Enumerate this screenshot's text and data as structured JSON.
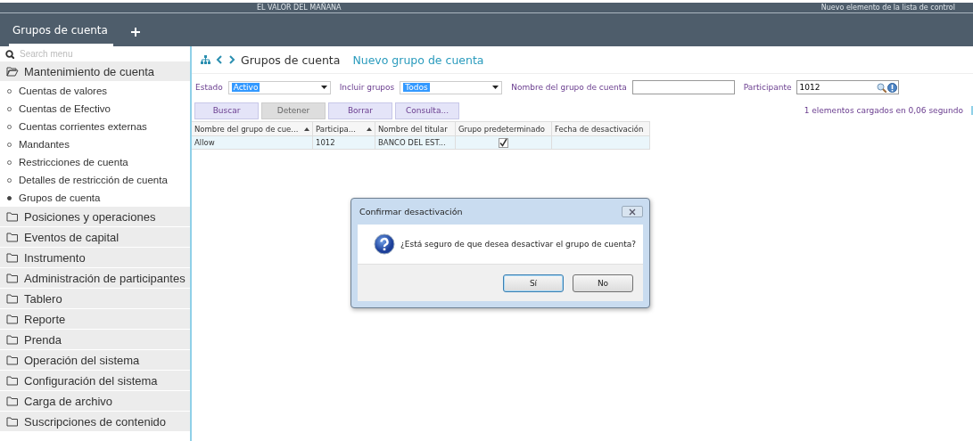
{
  "header": {
    "tagline": "EL VALOR DEL MAÑANA",
    "notice": "Nuevo elemento de la lista de control"
  },
  "tabs": [
    {
      "label": "Grupos de cuenta",
      "selected": true
    }
  ],
  "sidebar": {
    "search": {
      "placeholder": "Search menu"
    },
    "items": [
      {
        "label": "Mantenimiento de cuenta",
        "expanded": true,
        "children": [
          {
            "label": "Cuentas de valores",
            "selected": false
          },
          {
            "label": "Cuentas de Efectivo",
            "selected": false
          },
          {
            "label": "Cuentas corrientes externas",
            "selected": false
          },
          {
            "label": "Mandantes",
            "selected": false
          },
          {
            "label": "Restricciones de cuenta",
            "selected": false
          },
          {
            "label": "Detalles de restricción de cuenta",
            "selected": false
          },
          {
            "label": "Grupos de cuenta",
            "selected": true
          }
        ]
      },
      {
        "label": "Posiciones y operaciones",
        "expanded": false
      },
      {
        "label": "Eventos de capital",
        "expanded": false
      },
      {
        "label": "Instrumento",
        "expanded": false
      },
      {
        "label": "Administración de participantes",
        "expanded": false
      },
      {
        "label": "Tablero",
        "expanded": false
      },
      {
        "label": "Reporte",
        "expanded": false
      },
      {
        "label": "Prenda",
        "expanded": false
      },
      {
        "label": "Operación del sistema",
        "expanded": false
      },
      {
        "label": "Configuración del sistema",
        "expanded": false
      },
      {
        "label": "Carga de archivo",
        "expanded": false
      },
      {
        "label": "Suscripciones de contenido",
        "expanded": false
      }
    ]
  },
  "breadcrumb": {
    "title": "Grupos de cuenta",
    "action": "Nuevo grupo de cuenta"
  },
  "filters": [
    {
      "kind": "select",
      "label": "Estado",
      "value": "Activo"
    },
    {
      "kind": "select",
      "label": "Incluir grupos",
      "value": "Todos"
    },
    {
      "kind": "text",
      "label": "Nombre del grupo de cuenta"
    },
    {
      "kind": "lookup",
      "label": "Participante",
      "value": "1012"
    }
  ],
  "buttons": [
    {
      "label": "Buscar",
      "disabled": false
    },
    {
      "label": "Detener",
      "disabled": true
    },
    {
      "label": "Borrar",
      "disabled": false
    },
    {
      "label": "Consulta...",
      "disabled": false
    }
  ],
  "status": "1 elementos cargados en 0,06 segundo",
  "table": {
    "columns": [
      {
        "label": "Nombre del grupo de cue...",
        "sorted": true
      },
      {
        "label": "Participa...",
        "sorted": true
      },
      {
        "label": "Nombre del titular",
        "sorted": false
      },
      {
        "label": "Grupo predeterminado",
        "sorted": false
      },
      {
        "label": "Fecha de desactivación",
        "sorted": false
      }
    ],
    "rows": [
      {
        "selected": true,
        "cells": [
          {
            "kind": "text",
            "text": "Allow"
          },
          {
            "kind": "text",
            "text": "1012"
          },
          {
            "kind": "text",
            "text": "BANCO  DEL EST..."
          },
          {
            "kind": "check",
            "checked": true
          },
          {
            "kind": "text"
          }
        ]
      }
    ]
  },
  "dialog": {
    "title": "Confirmar desactivación",
    "message": "¿Está seguro de que desea desactivar el grupo de cuenta?",
    "buttons": [
      {
        "label": "Sí",
        "default": true
      },
      {
        "label": "No",
        "default": false
      }
    ]
  }
}
